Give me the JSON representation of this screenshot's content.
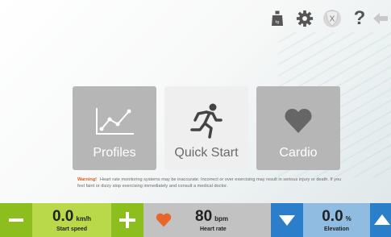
{
  "toolbar": {
    "icons": [
      "weight-icon",
      "gear-icon",
      "shield-x-icon",
      "help-icon",
      "back-arrow-icon"
    ],
    "shield_letter": "X",
    "help_glyph": "?"
  },
  "tiles": {
    "profiles": {
      "label": "Profiles",
      "icon": "line-chart-icon"
    },
    "quick_start": {
      "label": "Quick Start",
      "icon": "running-person-icon"
    },
    "cardio": {
      "label": "Cardio",
      "icon": "heart-icon"
    }
  },
  "warning": {
    "label": "Warning!",
    "text": "Heart rate monitoring systems may be inaccurate. Incorrect or over exercising may result in serious injury or death. If you feel faint or dizzy stop exercising immediately and consult a medical doctor."
  },
  "speed": {
    "value": "0.0",
    "unit": "km/h",
    "label": "Start speed",
    "decrease_icon": "minus-icon",
    "increase_icon": "plus-icon"
  },
  "heart_rate": {
    "value": "80",
    "unit": "bpm",
    "label": "Heart rate",
    "icon": "heart-icon"
  },
  "elevation": {
    "value": "0.0",
    "unit": "%",
    "label": "Elevation",
    "decrease_icon": "triangle-down-icon",
    "increase_icon": "triangle-up-icon"
  },
  "colors": {
    "speed_bg": "#b9d94a",
    "speed_btn": "#8cbe1e",
    "hr_bg": "#c2c2c2",
    "heart": "#e8662a",
    "elev_bg": "#8fbce0",
    "elev_btn": "#2b7fca",
    "warning": "#e05a1c"
  }
}
